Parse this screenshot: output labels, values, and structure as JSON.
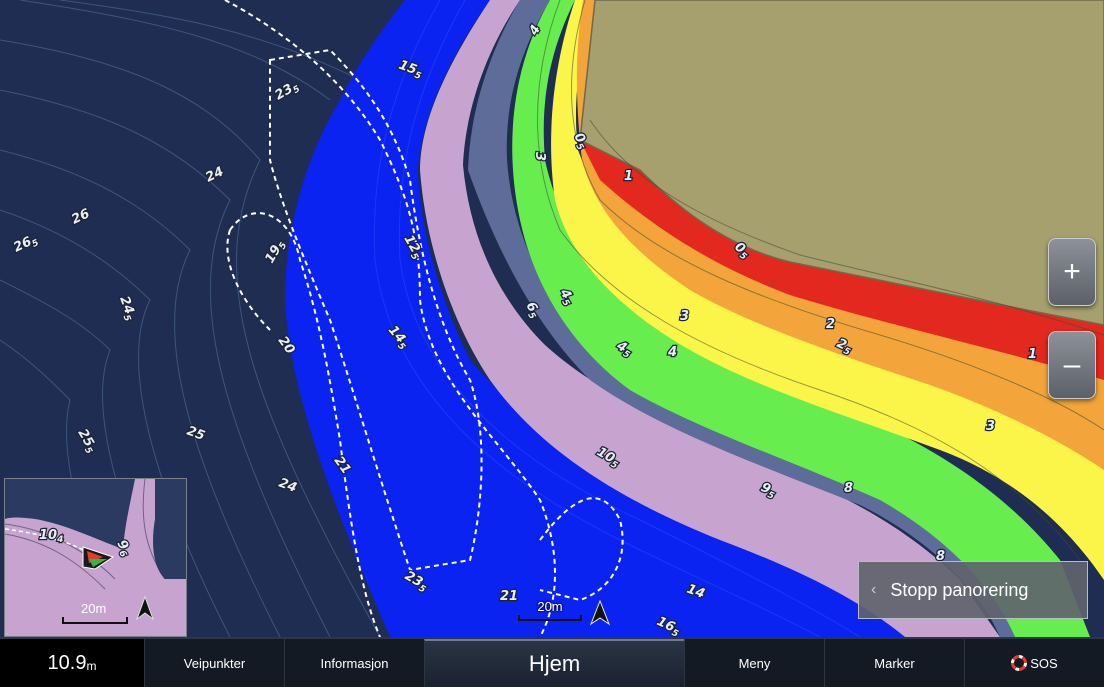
{
  "map": {
    "depth_labels": [
      {
        "text": "15",
        "sub": "5"
      },
      {
        "text": "23",
        "sub": "5"
      },
      {
        "text": "24",
        "sub": ""
      },
      {
        "text": "26",
        "sub": ""
      },
      {
        "text": "26",
        "sub": "5"
      },
      {
        "text": "24",
        "sub": "5"
      },
      {
        "text": "19",
        "sub": "5"
      },
      {
        "text": "12",
        "sub": "5"
      },
      {
        "text": "14",
        "sub": "5"
      },
      {
        "text": "20",
        "sub": ""
      },
      {
        "text": "25",
        "sub": "5"
      },
      {
        "text": "25",
        "sub": ""
      },
      {
        "text": "24",
        "sub": ""
      },
      {
        "text": "21",
        "sub": ""
      },
      {
        "text": "23",
        "sub": "5"
      },
      {
        "text": "21",
        "sub": ""
      },
      {
        "text": "16",
        "sub": "5"
      },
      {
        "text": "14",
        "sub": ""
      },
      {
        "text": "10",
        "sub": "5"
      },
      {
        "text": "9",
        "sub": "5"
      },
      {
        "text": "8",
        "sub": ""
      },
      {
        "text": "8",
        "sub": ""
      },
      {
        "text": "6",
        "sub": "5"
      },
      {
        "text": "4",
        "sub": "5"
      },
      {
        "text": "4",
        "sub": "5"
      },
      {
        "text": "4",
        "sub": ""
      },
      {
        "text": "3",
        "sub": ""
      },
      {
        "text": "3",
        "sub": ""
      },
      {
        "text": "0",
        "sub": "5"
      },
      {
        "text": "1",
        "sub": ""
      },
      {
        "text": "0",
        "sub": "5"
      },
      {
        "text": "2",
        "sub": ""
      },
      {
        "text": "2",
        "sub": "5"
      },
      {
        "text": "1",
        "sub": ""
      },
      {
        "text": "3",
        "sub": ""
      },
      {
        "text": "4",
        "sub": ""
      }
    ],
    "scale_label": "20m",
    "colors": {
      "deep": "#1f2d52",
      "blue": "#0a23f0",
      "lilac": "#c7a4cf",
      "slate": "#5d6c98",
      "green": "#67ee4e",
      "yellow": "#fbf54a",
      "orange": "#f3a43b",
      "red": "#e3281f",
      "land": "#a69f6e"
    }
  },
  "inset": {
    "scale_label": "20m",
    "depth_labels": [
      {
        "text": "10",
        "sub": "4"
      },
      {
        "text": "9",
        "sub": "6"
      }
    ]
  },
  "controls": {
    "zoom_in": "+",
    "zoom_out": "–",
    "stop_panning": "Stopp panorering"
  },
  "bottom_bar": {
    "depth_value": "10.9",
    "depth_unit": "m",
    "waypoints": "Veipunkter",
    "information": "Informasjon",
    "home": "Hjem",
    "menu": "Meny",
    "mark": "Marker",
    "sos": "SOS"
  }
}
